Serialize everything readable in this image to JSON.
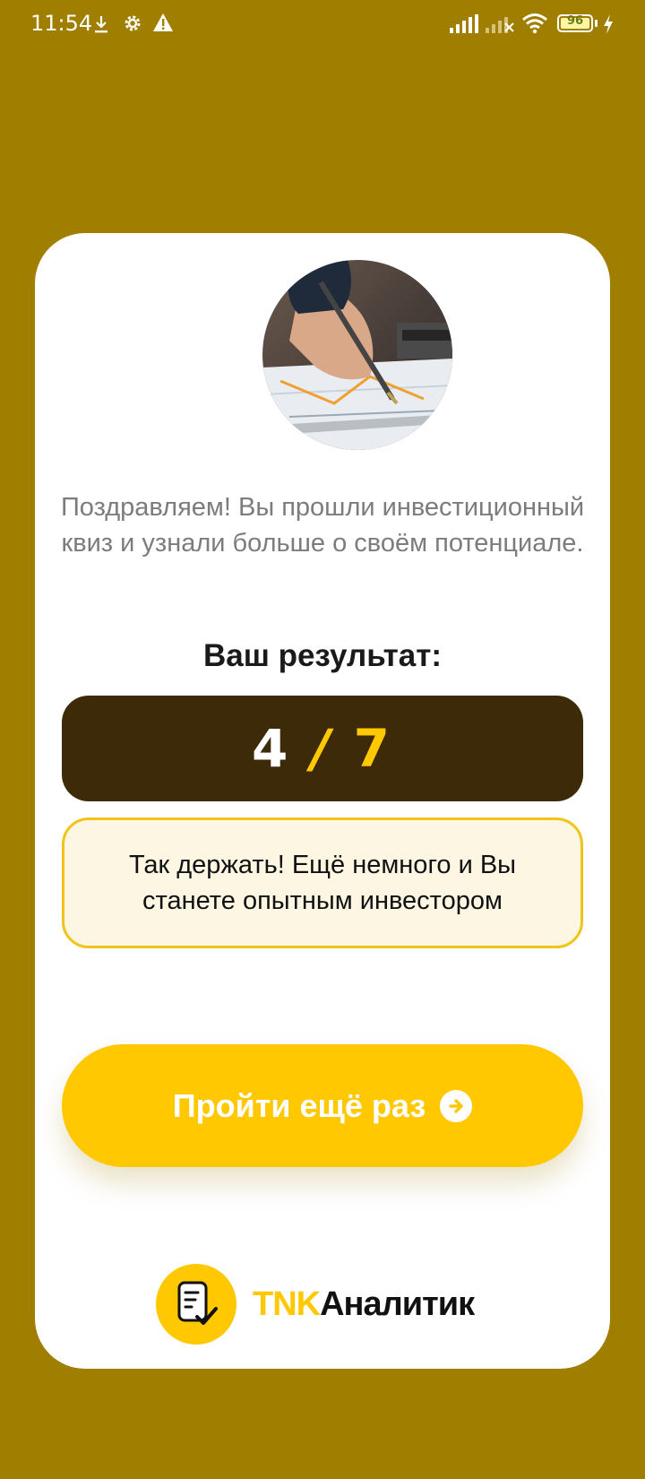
{
  "status_bar": {
    "time": "11:54",
    "battery_percent": "96",
    "left_icons": [
      "download-icon",
      "gear-icon",
      "warning-icon"
    ],
    "right_icons": [
      "signal-icon",
      "signal-no-service-icon",
      "wifi-icon",
      "battery-icon",
      "charging-icon"
    ]
  },
  "card": {
    "intro_text": "Поздравляем! Вы прошли инвестиционный квиз и узнали больше о своём потенциале.",
    "result_label": "Ваш результат:",
    "score": {
      "got": "4",
      "separator": "/",
      "total": "7"
    },
    "message": "Так держать! Ещё немного и Вы станете опытным инвестором",
    "retry_button_label": "Пройти ещё раз",
    "logo": {
      "prefix": "TNK",
      "name": "Аналитик"
    }
  },
  "colors": {
    "background": "#A07E00",
    "accent": "#FFC800",
    "score_box": "#3D2A08",
    "message_bg": "#FDF6E3",
    "message_border": "#F0C419"
  }
}
